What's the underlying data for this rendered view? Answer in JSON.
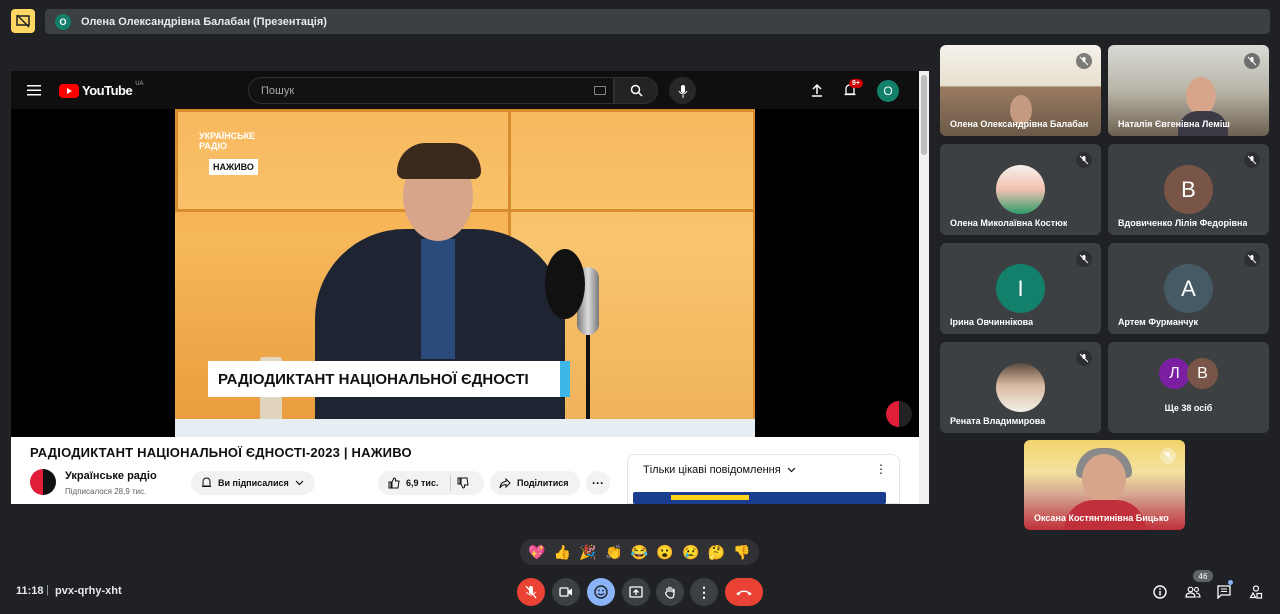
{
  "presentation_bar": {
    "avatar_letter": "О",
    "title": "Олена Олександрівна Балабан (Презентація)"
  },
  "youtube": {
    "logo_text": "YouTube",
    "region": "UA",
    "search_placeholder": "Пошук",
    "notification_count": "9+",
    "avatar_letter": "О",
    "video": {
      "brand_line1": "УКРАЇНСЬКЕ",
      "brand_line2": "РАДІО",
      "live_tag": "НАЖИВО",
      "lower_third": "РАДІОДИКТАНТ НАЦІОНАЛЬНОЇ ЄДНОСТІ"
    },
    "title": "РАДІОДИКТАНТ НАЦІОНАЛЬНОЇ ЄДНОСТІ-2023 | НАЖИВО",
    "channel_name": "Українське радіо",
    "channel_subs": "Підписалося 28,9 тис.",
    "subscribe_label": "Ви підписалися",
    "like_count": "6,9 тис.",
    "share_label": "Поділитися",
    "chat_header": "Тільки цікаві повідомлення"
  },
  "participants": [
    {
      "name": "Олена Олександрівна Балабан",
      "type": "video"
    },
    {
      "name": "Наталія Євгенівна Леміш",
      "type": "video"
    },
    {
      "name": "Олена Миколаївна Костюк",
      "type": "photo"
    },
    {
      "name": "Вдовиченко Лілія Федорівна",
      "type": "letter",
      "letter": "В",
      "color": "#795548"
    },
    {
      "name": "Ірина Овчиннікова",
      "type": "letter",
      "letter": "І",
      "color": "#12806a"
    },
    {
      "name": "Артем Фурманчук",
      "type": "letter",
      "letter": "А",
      "color": "#455a64"
    },
    {
      "name": "Рената Владимирова",
      "type": "photo"
    }
  ],
  "more_tile": {
    "letters": [
      "Л",
      "В"
    ],
    "colors": [
      "#7b1fa2",
      "#795548"
    ],
    "label": "Ще 38 осіб"
  },
  "self_tile": {
    "name": "Оксана Костянтинівна Бицько"
  },
  "reactions": [
    "💖",
    "👍",
    "🎉",
    "👏",
    "😂",
    "😮",
    "😢",
    "🤔",
    "👎"
  ],
  "bottom_bar": {
    "time": "11:18",
    "separator": "|",
    "meeting_code": "pvx-qrhy-xht",
    "people_count": "46"
  }
}
